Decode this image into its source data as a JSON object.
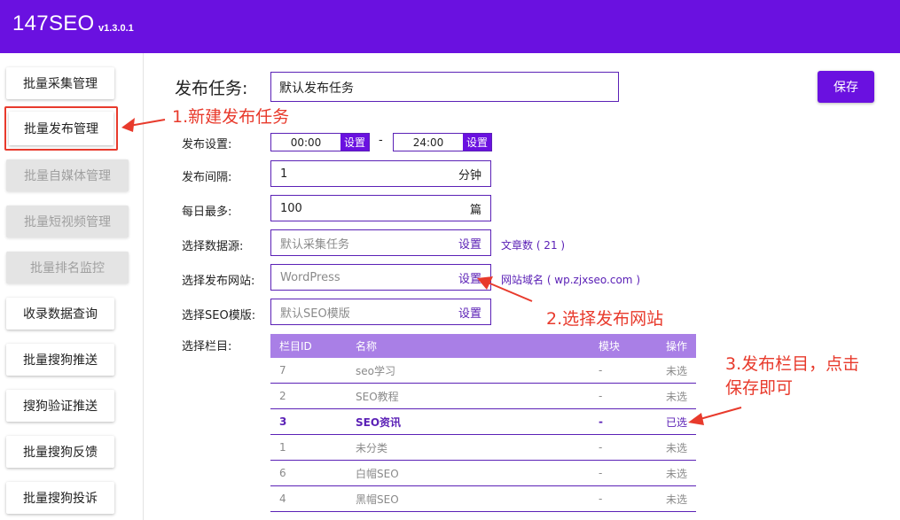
{
  "header": {
    "brand": "147SEO",
    "version": "v1.3.0.1"
  },
  "sidebar": {
    "items": [
      {
        "label": "批量采集管理",
        "state": "normal"
      },
      {
        "label": "批量发布管理",
        "state": "active"
      },
      {
        "label": "批量自媒体管理",
        "state": "disabled"
      },
      {
        "label": "批量短视频管理",
        "state": "disabled"
      },
      {
        "label": "批量排名监控",
        "state": "disabled"
      },
      {
        "label": "收录数据查询",
        "state": "normal"
      },
      {
        "label": "批量搜狗推送",
        "state": "normal"
      },
      {
        "label": "搜狗验证推送",
        "state": "normal"
      },
      {
        "label": "批量搜狗反馈",
        "state": "normal"
      },
      {
        "label": "批量搜狗投诉",
        "state": "normal"
      }
    ]
  },
  "task": {
    "label": "发布任务:",
    "value": "默认发布任务",
    "save": "保存"
  },
  "form": {
    "publish_setting": {
      "label": "发布设置:",
      "start": "00:00",
      "end": "24:00",
      "set": "设置",
      "dash": "-"
    },
    "interval": {
      "label": "发布间隔:",
      "value": "1",
      "unit": "分钟"
    },
    "daily_max": {
      "label": "每日最多:",
      "value": "100",
      "unit": "篇"
    },
    "datasource": {
      "label": "选择数据源:",
      "placeholder": "默认采集任务",
      "set": "设置",
      "note": "文章数 ( 21 )"
    },
    "site": {
      "label": "选择发布网站:",
      "placeholder": "WordPress",
      "set": "设置",
      "note": "网站域名 ( wp.zjxseo.com )"
    },
    "seo_template": {
      "label": "选择SEO模版:",
      "placeholder": "默认SEO模版",
      "set": "设置"
    },
    "column": {
      "label": "选择栏目:"
    }
  },
  "table": {
    "headers": {
      "id": "栏目ID",
      "name": "名称",
      "module": "模块",
      "op": "操作"
    },
    "rows": [
      {
        "id": "7",
        "name": "seo学习",
        "module": "-",
        "op": "未选",
        "selected": false
      },
      {
        "id": "2",
        "name": "SEO教程",
        "module": "-",
        "op": "未选",
        "selected": false
      },
      {
        "id": "3",
        "name": "SEO资讯",
        "module": "-",
        "op": "已选",
        "selected": true
      },
      {
        "id": "1",
        "name": "未分类",
        "module": "-",
        "op": "未选",
        "selected": false
      },
      {
        "id": "6",
        "name": "白帽SEO",
        "module": "-",
        "op": "未选",
        "selected": false
      },
      {
        "id": "4",
        "name": "黑帽SEO",
        "module": "-",
        "op": "未选",
        "selected": false
      }
    ]
  },
  "annotations": {
    "a1": "1.新建发布任务",
    "a2": "2.选择发布网站",
    "a3_line1": "3.发布栏目，点击",
    "a3_line2": "保存即可"
  },
  "colors": {
    "primary": "#6a11e0",
    "annotation": "#e83a2c",
    "table_header": "#a97fe6"
  }
}
